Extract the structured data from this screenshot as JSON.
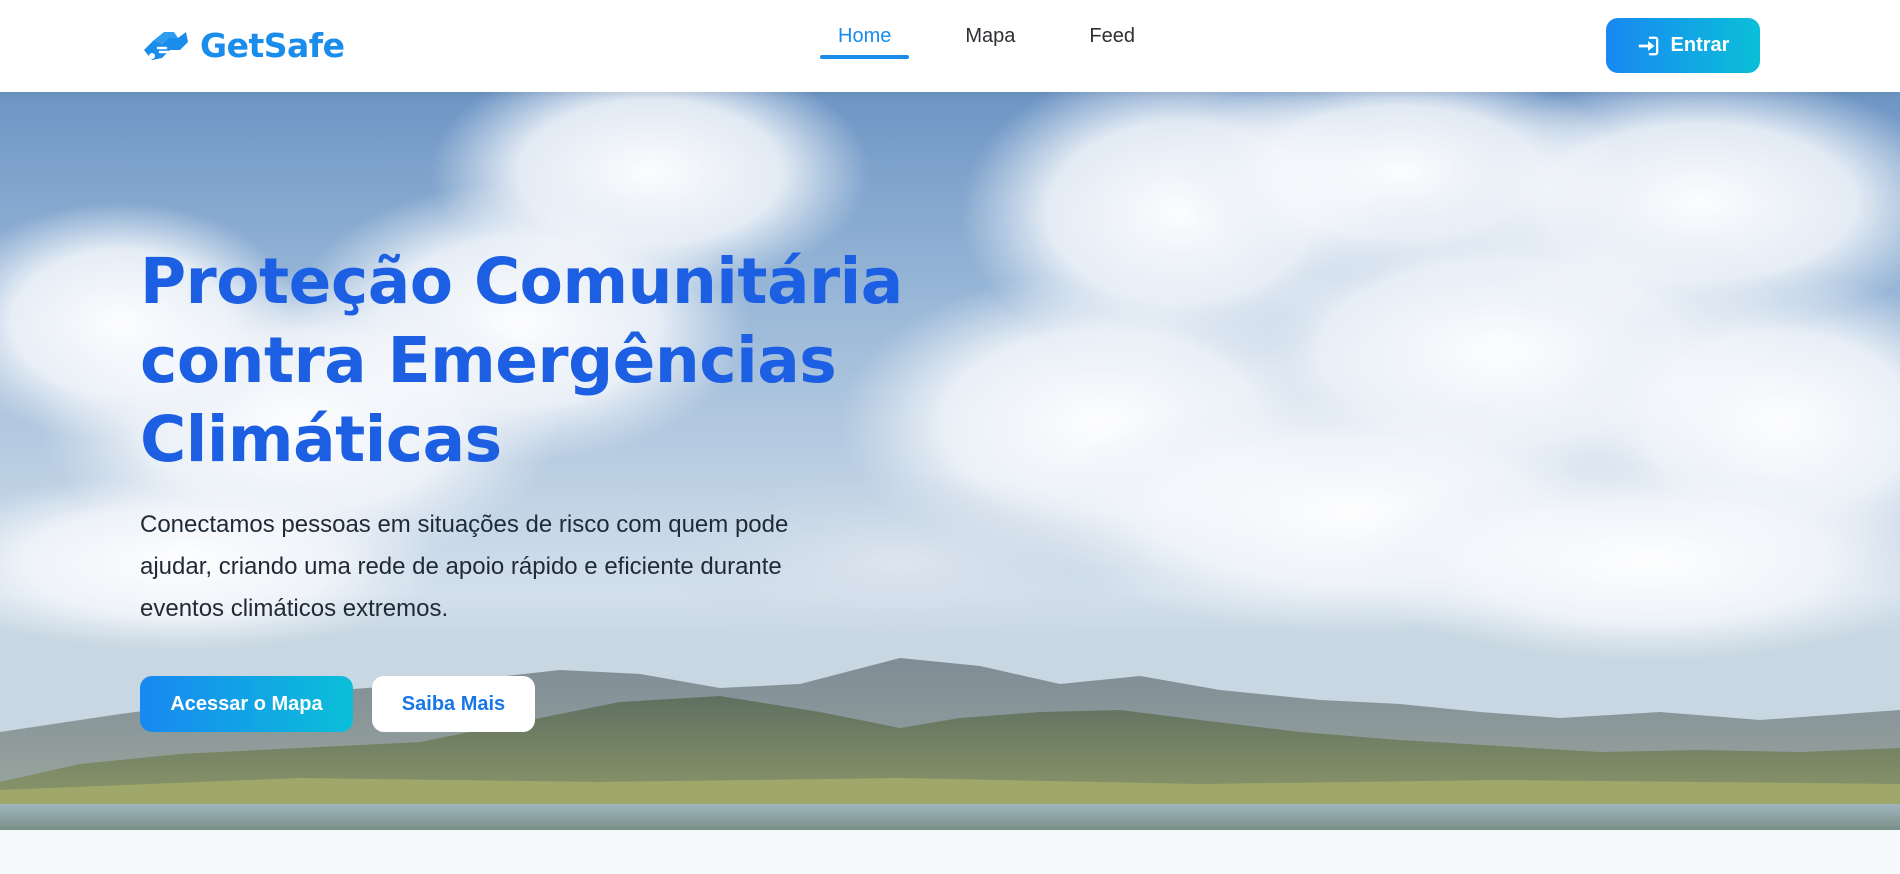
{
  "brand": {
    "name": "GetSafe",
    "icon": "handshake-icon",
    "color": "#1a8ceb"
  },
  "nav": {
    "items": [
      {
        "label": "Home",
        "active": true
      },
      {
        "label": "Mapa",
        "active": false
      },
      {
        "label": "Feed",
        "active": false
      }
    ],
    "login_button": {
      "label": "Entrar",
      "icon": "sign-in-icon"
    }
  },
  "hero": {
    "title_lines": [
      "Proteção Comunitária",
      "contra Emergências",
      "Climáticas"
    ],
    "description": "Conectamos pessoas em situações de risco com quem pode ajudar, criando uma rede de apoio rápido e eficiente durante eventos climáticos extremos.",
    "primary_button": "Acessar o Mapa",
    "secondary_button": "Saiba Mais",
    "background": "sky-clouds-mountains-lake-photo"
  },
  "colors": {
    "accent": "#1a8ceb",
    "title": "#1c5fe2",
    "gradient_start": "#1888f2",
    "gradient_end": "#0bbfd8"
  }
}
